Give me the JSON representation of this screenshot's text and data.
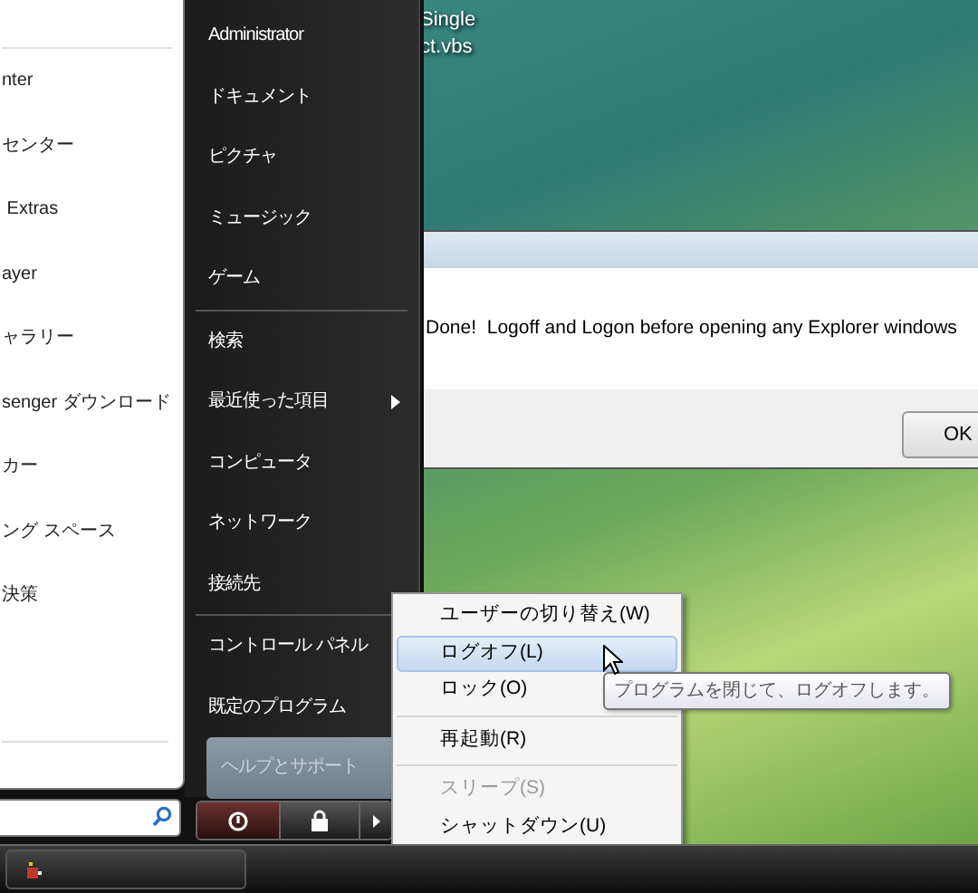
{
  "desktop_icon": {
    "label_lines": [
      "Single",
      "ct.vbs"
    ]
  },
  "dialog": {
    "message": "Done!  Logoff and Logon before opening any Explorer windows",
    "button": "OK"
  },
  "start_menu": {
    "programs": [
      {
        "label": "nter"
      },
      {
        "label": "センター"
      },
      {
        "label": " Extras"
      },
      {
        "label": "ayer"
      },
      {
        "label": "ャラリー"
      },
      {
        "label": "senger ダウンロード"
      },
      {
        "label": "カー"
      },
      {
        "label": "ング スペース"
      },
      {
        "label": "決策"
      }
    ],
    "place_groups": [
      {
        "items": [
          {
            "label": "Administrator",
            "selected": false,
            "has_submenu": false
          },
          {
            "label": "ドキュメント",
            "selected": false,
            "has_submenu": false
          },
          {
            "label": "ピクチャ",
            "selected": false,
            "has_submenu": false
          },
          {
            "label": "ミュージック",
            "selected": false,
            "has_submenu": false
          },
          {
            "label": "ゲーム",
            "selected": false,
            "has_submenu": false
          }
        ]
      },
      {
        "items": [
          {
            "label": "検索",
            "selected": false,
            "has_submenu": false
          },
          {
            "label": "最近使った項目",
            "selected": false,
            "has_submenu": true
          },
          {
            "label": "コンピュータ",
            "selected": false,
            "has_submenu": false
          },
          {
            "label": "ネットワーク",
            "selected": false,
            "has_submenu": false
          },
          {
            "label": "接続先",
            "selected": false,
            "has_submenu": false
          }
        ]
      },
      {
        "items": [
          {
            "label": "コントロール パネル",
            "selected": false,
            "has_submenu": false
          },
          {
            "label": "既定のプログラム",
            "selected": false,
            "has_submenu": false
          },
          {
            "label": "ヘルプとサポート",
            "selected": true,
            "has_submenu": false
          }
        ]
      }
    ]
  },
  "shutdown_menu": {
    "groups": [
      {
        "items": [
          {
            "label": "ユーザーの切り替え(W)",
            "selected": false,
            "disabled": false
          },
          {
            "label": "ログオフ(L)",
            "selected": true,
            "disabled": false
          },
          {
            "label": "ロック(O)",
            "selected": false,
            "disabled": false
          }
        ]
      },
      {
        "items": [
          {
            "label": "再起動(R)",
            "selected": false,
            "disabled": false
          }
        ]
      },
      {
        "items": [
          {
            "label": "スリープ(S)",
            "selected": false,
            "disabled": true
          },
          {
            "label": "シャットダウン(U)",
            "selected": false,
            "disabled": false
          }
        ]
      }
    ]
  },
  "tooltip": "プログラムを閉じて、ログオフします。"
}
